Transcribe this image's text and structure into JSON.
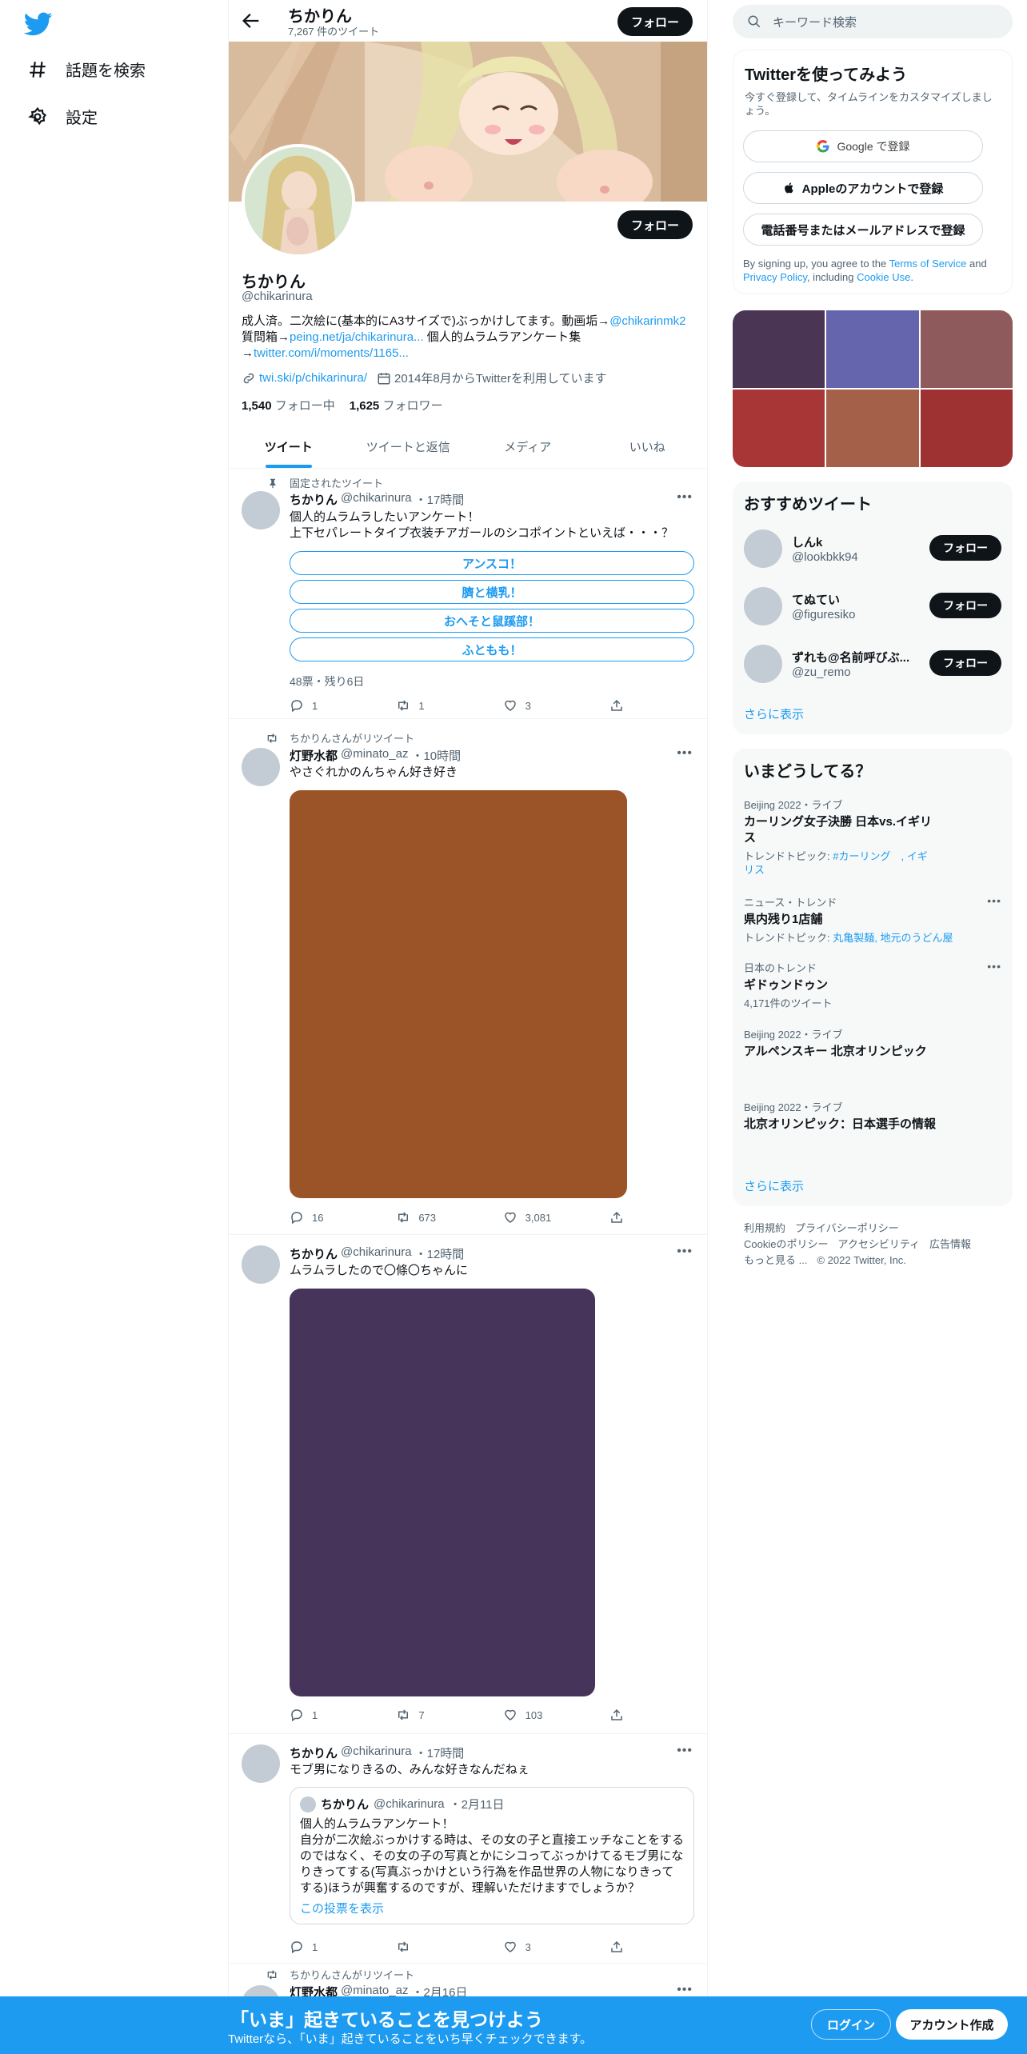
{
  "nav": {
    "explore_label": "話題を検索",
    "settings_label": "設定"
  },
  "topbar": {
    "name": "ちかりん",
    "tweet_count": "7,267 件のツイート",
    "follow_label": "フォロー"
  },
  "profile": {
    "follow_label": "フォロー",
    "name": "ちかりん",
    "handle": "@chikarinura",
    "bio_1": "成人済。二次絵に(基本的にA3サイズで)ぶっかけしてます。動画垢→",
    "bio_link_1": "@chikarinmk2",
    "bio_2": "質問箱→",
    "bio_link_2": "peing.net/ja/chikarinura...",
    "bio_3": " 個人的ムラムラアンケート集",
    "bio_4": "→",
    "bio_link_3": "twitter.com/i/moments/1165...",
    "website": "twi.ski/p/chikarinura/",
    "joined": "2014年8月からTwitterを利用しています",
    "following_count": "1,540",
    "following_label": "フォロー中",
    "followers_count": "1,625",
    "followers_label": "フォロワー"
  },
  "tabs": [
    "ツイート",
    "ツイートと返信",
    "メディア",
    "いいね"
  ],
  "tweets": [
    {
      "social": "固定されたツイート",
      "name": "ちかりん",
      "handle": "@chikarinura",
      "time": "・17時間",
      "text_1": "個人的ムラムラしたいアンケート！",
      "text_2": "上下セパレートタイプ衣装チアガールのシコポイントといえば・・・？",
      "poll": [
        "アンスコ！",
        "臍と横乳！",
        "おへそと鼠蹊部！",
        "ふともも！"
      ],
      "poll_meta": "48票・残り6日",
      "reply": "1",
      "retweet": "1",
      "like": "3"
    },
    {
      "social": "ちかりんさんがリツイート",
      "name": "灯野水都",
      "handle": "@minato_az",
      "time": "・10時間",
      "text_1": "やさぐれかのんちゃん好き好き",
      "media_color": "#9b5428",
      "reply": "16",
      "retweet": "673",
      "like": "3,081"
    },
    {
      "name": "ちかりん",
      "handle": "@chikarinura",
      "time": "・12時間",
      "text_1": "ムラムラしたので〇條〇ちゃんに",
      "media_color": "#47345a",
      "reply": "1",
      "retweet": "7",
      "like": "103"
    },
    {
      "name": "ちかりん",
      "handle": "@chikarinura",
      "time": "・17時間",
      "text_1": "モブ男になりきるの、みんな好きなんだねぇ",
      "quote_name": "ちかりん",
      "quote_handle": "@chikarinura",
      "quote_time": "・2月11日",
      "quote_text": "個人的ムラムラアンケート！\n自分が二次絵ぶっかけする時は、その女の子と直接エッチなことをするのではなく、その女の子の写真とかにシコってぶっかけてるモブ男になりきってする(写真ぶっかけという行為を作品世界の人物になりきってする)ほうが興奮するのですが、理解いただけますでしょうか？",
      "quote_link": "この投票を表示",
      "reply": "1",
      "retweet": "",
      "like": "3"
    },
    {
      "social": "ちかりんさんがリツイート",
      "name": "灯野水都",
      "handle": "@minato_az",
      "time": "・2月16日"
    }
  ],
  "right": {
    "search_placeholder": "キーワード検索",
    "signup": {
      "title": "Twitterを使ってみよう",
      "subtitle": "今すぐ登録して、タイムラインをカスタマイズしましょう。",
      "google": "Google で登録",
      "apple": "Appleのアカウントで登録",
      "phone": "電話番号またはメールアドレスで登録",
      "legal_1": "By signing up, you agree to the ",
      "terms": "Terms of Service",
      "legal_2": " and ",
      "privacy": "Privacy Policy",
      "legal_3": ", including ",
      "cookie": "Cookie Use",
      "legal_4": "."
    },
    "media_colors": [
      "#4b3554",
      "#6565ad",
      "#8f5a5b",
      "#a83636",
      "#a46048",
      "#9e3232"
    ],
    "reco": {
      "title": "おすすめツイート",
      "users": [
        {
          "name": "しんk",
          "handle": "@lookbkk94",
          "button": "フォロー"
        },
        {
          "name": "てぬてい",
          "handle": "@figuresiko",
          "button": "フォロー"
        },
        {
          "name": "ずれも@名前呼びぶ...",
          "handle": "@zu_remo",
          "button": "フォロー"
        }
      ],
      "more": "さらに表示"
    },
    "trends": {
      "title": "いまどうしてる？",
      "items": [
        {
          "cat": "Beijing 2022・ライブ",
          "title": "カーリング女子決勝 日本vs.イギリス",
          "sub_label": "トレンドトピック: ",
          "sub_link": "#カーリング　, イギリス"
        },
        {
          "cat": "ニュース・トレンド",
          "title": "県内残り1店舗",
          "sub_label": "トレンドトピック: ",
          "sub_link": "丸亀製麺, 地元のうどん屋"
        },
        {
          "cat": "日本のトレンド",
          "title": "ギドゥンドゥン",
          "sub_label": "4,171件のツイート",
          "sub_link": ""
        },
        {
          "cat": "Beijing 2022・ライブ",
          "title": "アルペンスキー 北京オリンピック",
          "sub_label": "",
          "sub_link": ""
        },
        {
          "cat": "Beijing 2022・ライブ",
          "title": "北京オリンピック：日本選手の情報",
          "sub_label": "",
          "sub_link": ""
        }
      ],
      "more": "さらに表示"
    },
    "footer": {
      "terms": "利用規約",
      "privacy": "プライバシーポリシー",
      "cookie": "Cookieのポリシー",
      "accessibility": "アクセシビリティ",
      "ads": "広告情報",
      "more": "もっと見る ...",
      "copyright": "© 2022 Twitter, Inc."
    }
  },
  "bottombar": {
    "title": "「いま」起きていることを見つけよう",
    "subtitle": "Twitterなら、「いま」起きていることをいち早くチェックできます。",
    "login": "ログイン",
    "signup": "アカウント作成"
  },
  "colors": {
    "accent": "#1d9bf0",
    "dark": "#0f1419",
    "muted": "#536471"
  }
}
